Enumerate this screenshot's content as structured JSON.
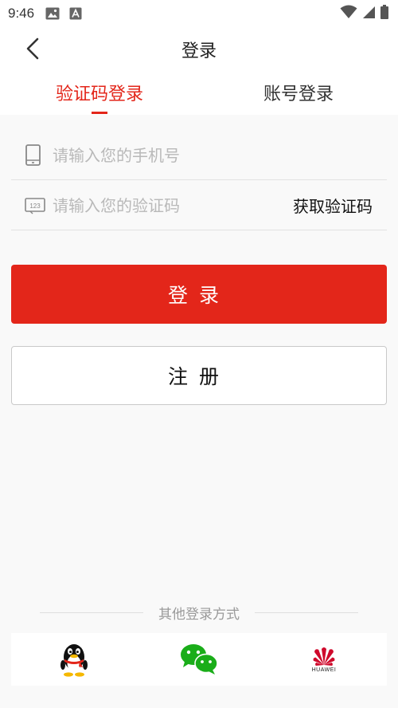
{
  "status_bar": {
    "time": "9:46"
  },
  "header": {
    "title": "登录"
  },
  "tabs": [
    {
      "label": "验证码登录",
      "active": true
    },
    {
      "label": "账号登录",
      "active": false
    }
  ],
  "form": {
    "phone_placeholder": "请输入您的手机号",
    "phone_value": "",
    "code_placeholder": "请输入您的验证码",
    "code_value": "",
    "code_icon_text": "123",
    "get_code_label": "获取验证码"
  },
  "buttons": {
    "login_label": "登录",
    "register_label": "注册"
  },
  "other_login": {
    "title": "其他登录方式",
    "providers": [
      {
        "name": "QQ",
        "icon": "qq-penguin-icon"
      },
      {
        "name": "WeChat",
        "icon": "wechat-icon"
      },
      {
        "name": "HUAWEI",
        "icon": "huawei-icon",
        "text": "HUAWEI"
      }
    ]
  },
  "colors": {
    "accent": "#e3261a",
    "background": "#f9f9f9",
    "wechat": "#1aad19",
    "huawei": "#cf0a2c"
  }
}
